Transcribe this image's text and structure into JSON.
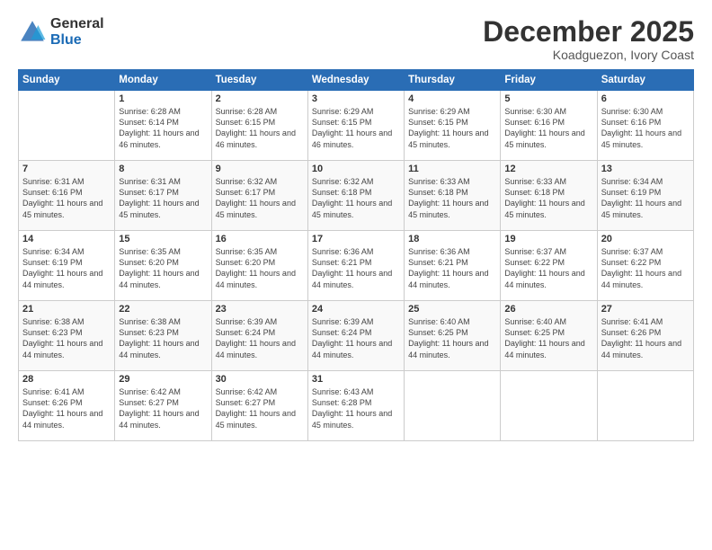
{
  "logo": {
    "general": "General",
    "blue": "Blue"
  },
  "title": "December 2025",
  "location": "Koadguezon, Ivory Coast",
  "days_of_week": [
    "Sunday",
    "Monday",
    "Tuesday",
    "Wednesday",
    "Thursday",
    "Friday",
    "Saturday"
  ],
  "weeks": [
    [
      {
        "num": "",
        "sunrise": "",
        "sunset": "",
        "daylight": ""
      },
      {
        "num": "1",
        "sunrise": "Sunrise: 6:28 AM",
        "sunset": "Sunset: 6:14 PM",
        "daylight": "Daylight: 11 hours and 46 minutes."
      },
      {
        "num": "2",
        "sunrise": "Sunrise: 6:28 AM",
        "sunset": "Sunset: 6:15 PM",
        "daylight": "Daylight: 11 hours and 46 minutes."
      },
      {
        "num": "3",
        "sunrise": "Sunrise: 6:29 AM",
        "sunset": "Sunset: 6:15 PM",
        "daylight": "Daylight: 11 hours and 46 minutes."
      },
      {
        "num": "4",
        "sunrise": "Sunrise: 6:29 AM",
        "sunset": "Sunset: 6:15 PM",
        "daylight": "Daylight: 11 hours and 45 minutes."
      },
      {
        "num": "5",
        "sunrise": "Sunrise: 6:30 AM",
        "sunset": "Sunset: 6:16 PM",
        "daylight": "Daylight: 11 hours and 45 minutes."
      },
      {
        "num": "6",
        "sunrise": "Sunrise: 6:30 AM",
        "sunset": "Sunset: 6:16 PM",
        "daylight": "Daylight: 11 hours and 45 minutes."
      }
    ],
    [
      {
        "num": "7",
        "sunrise": "Sunrise: 6:31 AM",
        "sunset": "Sunset: 6:16 PM",
        "daylight": "Daylight: 11 hours and 45 minutes."
      },
      {
        "num": "8",
        "sunrise": "Sunrise: 6:31 AM",
        "sunset": "Sunset: 6:17 PM",
        "daylight": "Daylight: 11 hours and 45 minutes."
      },
      {
        "num": "9",
        "sunrise": "Sunrise: 6:32 AM",
        "sunset": "Sunset: 6:17 PM",
        "daylight": "Daylight: 11 hours and 45 minutes."
      },
      {
        "num": "10",
        "sunrise": "Sunrise: 6:32 AM",
        "sunset": "Sunset: 6:18 PM",
        "daylight": "Daylight: 11 hours and 45 minutes."
      },
      {
        "num": "11",
        "sunrise": "Sunrise: 6:33 AM",
        "sunset": "Sunset: 6:18 PM",
        "daylight": "Daylight: 11 hours and 45 minutes."
      },
      {
        "num": "12",
        "sunrise": "Sunrise: 6:33 AM",
        "sunset": "Sunset: 6:18 PM",
        "daylight": "Daylight: 11 hours and 45 minutes."
      },
      {
        "num": "13",
        "sunrise": "Sunrise: 6:34 AM",
        "sunset": "Sunset: 6:19 PM",
        "daylight": "Daylight: 11 hours and 45 minutes."
      }
    ],
    [
      {
        "num": "14",
        "sunrise": "Sunrise: 6:34 AM",
        "sunset": "Sunset: 6:19 PM",
        "daylight": "Daylight: 11 hours and 44 minutes."
      },
      {
        "num": "15",
        "sunrise": "Sunrise: 6:35 AM",
        "sunset": "Sunset: 6:20 PM",
        "daylight": "Daylight: 11 hours and 44 minutes."
      },
      {
        "num": "16",
        "sunrise": "Sunrise: 6:35 AM",
        "sunset": "Sunset: 6:20 PM",
        "daylight": "Daylight: 11 hours and 44 minutes."
      },
      {
        "num": "17",
        "sunrise": "Sunrise: 6:36 AM",
        "sunset": "Sunset: 6:21 PM",
        "daylight": "Daylight: 11 hours and 44 minutes."
      },
      {
        "num": "18",
        "sunrise": "Sunrise: 6:36 AM",
        "sunset": "Sunset: 6:21 PM",
        "daylight": "Daylight: 11 hours and 44 minutes."
      },
      {
        "num": "19",
        "sunrise": "Sunrise: 6:37 AM",
        "sunset": "Sunset: 6:22 PM",
        "daylight": "Daylight: 11 hours and 44 minutes."
      },
      {
        "num": "20",
        "sunrise": "Sunrise: 6:37 AM",
        "sunset": "Sunset: 6:22 PM",
        "daylight": "Daylight: 11 hours and 44 minutes."
      }
    ],
    [
      {
        "num": "21",
        "sunrise": "Sunrise: 6:38 AM",
        "sunset": "Sunset: 6:23 PM",
        "daylight": "Daylight: 11 hours and 44 minutes."
      },
      {
        "num": "22",
        "sunrise": "Sunrise: 6:38 AM",
        "sunset": "Sunset: 6:23 PM",
        "daylight": "Daylight: 11 hours and 44 minutes."
      },
      {
        "num": "23",
        "sunrise": "Sunrise: 6:39 AM",
        "sunset": "Sunset: 6:24 PM",
        "daylight": "Daylight: 11 hours and 44 minutes."
      },
      {
        "num": "24",
        "sunrise": "Sunrise: 6:39 AM",
        "sunset": "Sunset: 6:24 PM",
        "daylight": "Daylight: 11 hours and 44 minutes."
      },
      {
        "num": "25",
        "sunrise": "Sunrise: 6:40 AM",
        "sunset": "Sunset: 6:25 PM",
        "daylight": "Daylight: 11 hours and 44 minutes."
      },
      {
        "num": "26",
        "sunrise": "Sunrise: 6:40 AM",
        "sunset": "Sunset: 6:25 PM",
        "daylight": "Daylight: 11 hours and 44 minutes."
      },
      {
        "num": "27",
        "sunrise": "Sunrise: 6:41 AM",
        "sunset": "Sunset: 6:26 PM",
        "daylight": "Daylight: 11 hours and 44 minutes."
      }
    ],
    [
      {
        "num": "28",
        "sunrise": "Sunrise: 6:41 AM",
        "sunset": "Sunset: 6:26 PM",
        "daylight": "Daylight: 11 hours and 44 minutes."
      },
      {
        "num": "29",
        "sunrise": "Sunrise: 6:42 AM",
        "sunset": "Sunset: 6:27 PM",
        "daylight": "Daylight: 11 hours and 44 minutes."
      },
      {
        "num": "30",
        "sunrise": "Sunrise: 6:42 AM",
        "sunset": "Sunset: 6:27 PM",
        "daylight": "Daylight: 11 hours and 45 minutes."
      },
      {
        "num": "31",
        "sunrise": "Sunrise: 6:43 AM",
        "sunset": "Sunset: 6:28 PM",
        "daylight": "Daylight: 11 hours and 45 minutes."
      },
      {
        "num": "",
        "sunrise": "",
        "sunset": "",
        "daylight": ""
      },
      {
        "num": "",
        "sunrise": "",
        "sunset": "",
        "daylight": ""
      },
      {
        "num": "",
        "sunrise": "",
        "sunset": "",
        "daylight": ""
      }
    ]
  ]
}
